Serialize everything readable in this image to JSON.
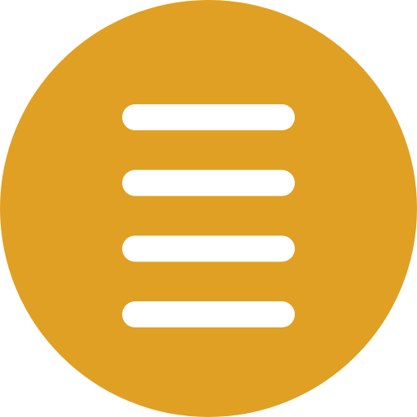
{
  "menu_button": {
    "icon": "hamburger-menu-icon",
    "lines": 4
  },
  "colors": {
    "circle": "#E0A024",
    "lines": "#FFFFFF"
  }
}
